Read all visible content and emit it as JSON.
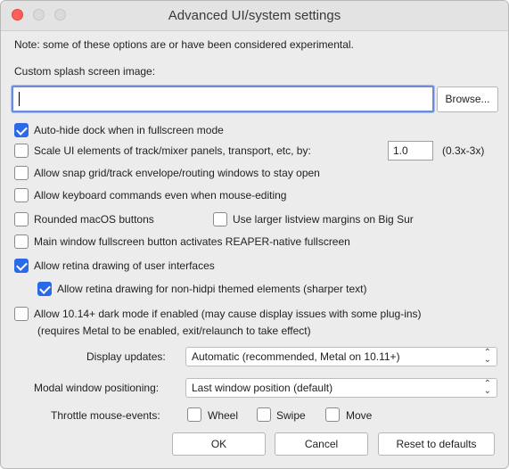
{
  "window": {
    "title": "Advanced UI/system settings"
  },
  "note": "Note: some of these options are or have been considered experimental.",
  "splash": {
    "label": "Custom splash screen image:",
    "value": "",
    "browse_label": "Browse..."
  },
  "options": {
    "auto_hide_dock": {
      "label": "Auto-hide dock when in fullscreen mode",
      "checked": true
    },
    "scale_ui": {
      "label": "Scale UI elements of track/mixer panels, transport, etc, by:",
      "checked": false,
      "value": "1.0",
      "range_hint": "(0.3x-3x)"
    },
    "snap_grid": {
      "label": "Allow snap grid/track envelope/routing windows to stay open",
      "checked": false
    },
    "keyboard_cmds": {
      "label": "Allow keyboard commands even when mouse-editing",
      "checked": false
    },
    "rounded_buttons": {
      "label": "Rounded macOS buttons",
      "checked": false
    },
    "larger_margins": {
      "label": "Use larger listview margins on Big Sur",
      "checked": false
    },
    "fullscreen_button": {
      "label": "Main window fullscreen button activates REAPER-native fullscreen",
      "checked": false
    },
    "retina": {
      "label": "Allow retina drawing of user interfaces",
      "checked": true
    },
    "retina_nonhidpi": {
      "label": "Allow retina drawing for non-hidpi themed elements (sharper text)",
      "checked": true
    },
    "dark_mode": {
      "label": "Allow 10.14+ dark mode if enabled (may cause display issues with some plug-ins)",
      "note": "(requires Metal to be enabled, exit/relaunch to take effect)",
      "checked": false
    }
  },
  "display_updates": {
    "label": "Display updates:",
    "value": "Automatic (recommended, Metal on 10.11+)"
  },
  "modal_positioning": {
    "label": "Modal window positioning:",
    "value": "Last window position (default)"
  },
  "throttle": {
    "label": "Throttle mouse-events:",
    "wheel": {
      "label": "Wheel",
      "checked": false
    },
    "swipe": {
      "label": "Swipe",
      "checked": false
    },
    "move": {
      "label": "Move",
      "checked": false
    }
  },
  "buttons": {
    "ok": "OK",
    "cancel": "Cancel",
    "reset": "Reset to defaults"
  },
  "colors": {
    "accent": "#2b6ae6",
    "close": "#ff5f57",
    "focus_ring": "#6d8bd9"
  }
}
